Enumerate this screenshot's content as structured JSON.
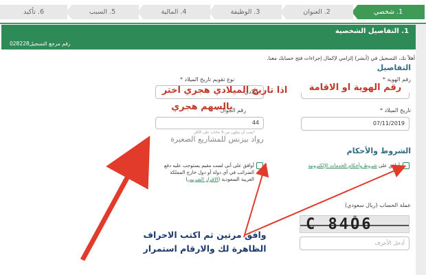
{
  "stepper": {
    "steps": [
      {
        "label": "1. شخصي",
        "active": true
      },
      {
        "label": "2. العنوان",
        "active": false
      },
      {
        "label": "3. الوظيفة",
        "active": false
      },
      {
        "label": "4. المالية",
        "active": false
      },
      {
        "label": "5. السبب",
        "active": false
      },
      {
        "label": "6. تأكيد",
        "active": false
      }
    ]
  },
  "section": {
    "title": "1. التفاصيل الشخصية",
    "reference_label": "رقم مرجع التسجيل028228"
  },
  "intro_text": "أهلاً بك، التسجيل في (أبشر) إلزامي لإكمال إجراءات فتح حسابك معنا.",
  "details": {
    "heading": "التفاصيل",
    "id_number": {
      "label": "رقم الهوية *",
      "value": ""
    },
    "calendar_type": {
      "label": "نوع تقويم تاريخ الميلاد *",
      "value": "ميلادي"
    },
    "birth_date": {
      "label": "تاريخ الميلاد *",
      "value": "07/11/2019"
    },
    "mobile": {
      "label": "رقم الجوال *",
      "value": "44",
      "hint": "*يجب أن يتكون من 9 خانات على الأقل"
    }
  },
  "terms": {
    "heading": "الشروط والأحكام",
    "agree_prefix": "أوافق على ",
    "agree_link": "شروط وأحكام الخدمات الإلكترونية",
    "tax_text": "أوافق على أني لست مقيم يستوجب عليه دفع الضرائب في أي دولة أو دول خارج المملكة العربية السعودية",
    "tax_link": "الاقرار الضريبي"
  },
  "currency": {
    "label": "عملة الحساب (ريال سعودي)"
  },
  "captcha": {
    "text": "C 84Ŏ6",
    "input_placeholder": "أدخل الأحرف"
  },
  "annotations": {
    "id_note": "رقم الهوية او الاقامة",
    "calendar_note_1": "اذا تاريخ الميلادي هجري اختر",
    "calendar_note_2": "بالسهم هجري",
    "watermark": "رواد بيزنس للمشاريع الصغيرة",
    "agree_note_1": "وافق مرتين ثم اكتب الاحراف",
    "agree_note_2": "الظاهرة لك والارقام استمرار"
  },
  "colors": {
    "accent_green": "#2e8b57",
    "annotation_red": "#c0392b",
    "annotation_navy": "#1e3a6e"
  }
}
